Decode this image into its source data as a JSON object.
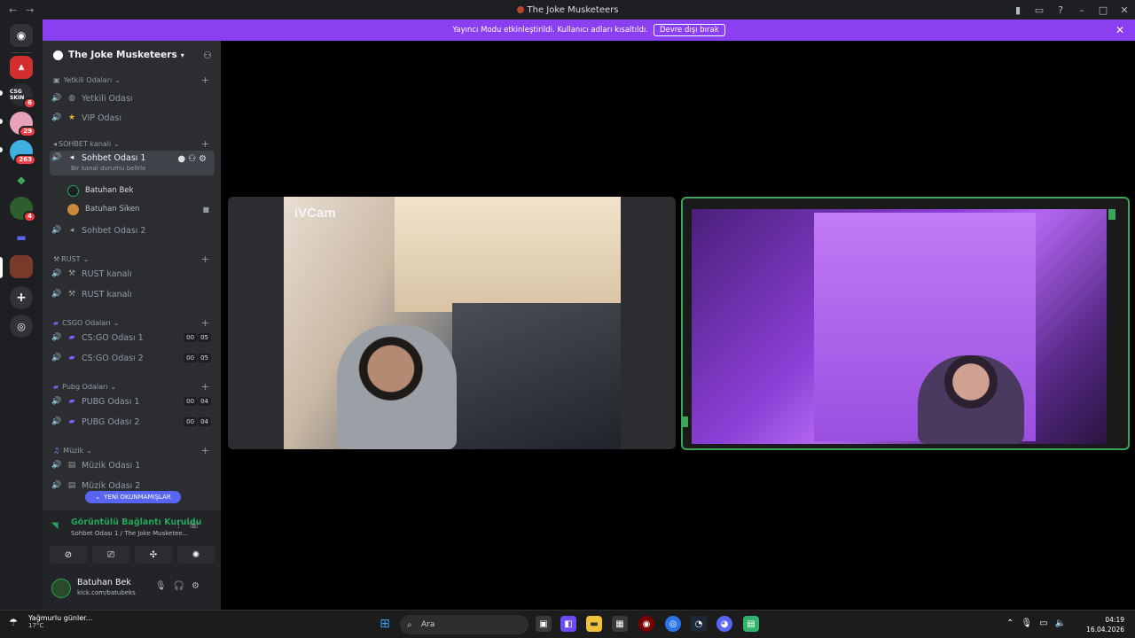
{
  "window": {
    "title": "The Joke Musketeers"
  },
  "notice": {
    "text": "Yayıncı Modu etkinleştirildi. Kullanıcı adları kısaltıldı.",
    "button": "Devre dışı bırak"
  },
  "rail": {
    "badges": [
      "6",
      "29",
      "263",
      "4"
    ],
    "server_labels": [
      "CSG SKIN"
    ]
  },
  "server": {
    "name": "The Joke Musketeers"
  },
  "categories": [
    {
      "label": "Yetkili Odaları"
    },
    {
      "label": "SOHBET kanalı"
    },
    {
      "label": "RUST"
    },
    {
      "label": "CSGO Odaları"
    },
    {
      "label": "Pubg Odaları"
    },
    {
      "label": "Müzik"
    }
  ],
  "channels": {
    "yetkili1": "Yetkili Odası",
    "vip": "VIP Odası",
    "sohbet1": "Sohbet Odası 1",
    "sohbet1_sub": "Bir kanal durumu belirle",
    "sohbet2": "Sohbet Odası 2",
    "rust1": "RUST kanalı",
    "rust2": "RUST kanalı",
    "csgo1": "CS:GO Odası 1",
    "csgo2": "CS:GO Odası 2",
    "pubg1": "PUBG Odası 1",
    "pubg2": "PUBG Odası 2",
    "muzik1": "Müzik Odası 1",
    "muzik2": "Müzik Odası 2"
  },
  "counts": {
    "csgo1": [
      "00",
      "05"
    ],
    "csgo2": [
      "00",
      "05"
    ],
    "pubg1": [
      "00",
      "04"
    ],
    "pubg2": [
      "00",
      "04"
    ]
  },
  "voice_users": [
    "Batuhan Bek",
    "Batuhan Siken"
  ],
  "unread_pill": "YENİ OKUNMAMIŞLAR",
  "voice_panel": {
    "status": "Görüntülü Bağlantı Kuruldu",
    "location": "Sohbet Odası 1 / The Joke Musketee..."
  },
  "user_panel": {
    "name": "Batuhan Bek",
    "subtitle": "kick.com/batubeks"
  },
  "video": {
    "watermark": "iVCam"
  },
  "taskbar": {
    "weather_text": "Yağmurlu günler...",
    "temperature": "17°C",
    "weather_badge": "2",
    "search_placeholder": "Ara",
    "time": "04:19",
    "date": "16.04.2026"
  },
  "colors": {
    "accent": "#8a3ff0",
    "speaking": "#3ba55c",
    "sidebar": "#2b2d31",
    "rail": "#1e1f22"
  }
}
